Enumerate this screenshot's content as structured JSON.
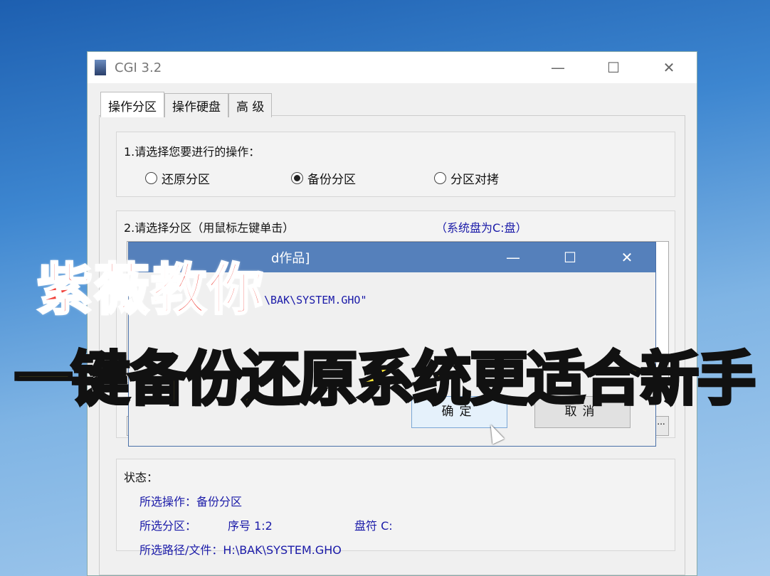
{
  "window": {
    "title": "CGI 3.2",
    "minimize": "—",
    "maximize": "☐",
    "close": "✕"
  },
  "tabs": [
    {
      "label": "操作分区"
    },
    {
      "label": "操作硬盘"
    },
    {
      "label": "高 级"
    }
  ],
  "step1": {
    "label": "1.请选择您要进行的操作：",
    "options": [
      {
        "label": "还原分区",
        "selected": false
      },
      {
        "label": "备份分区",
        "selected": true
      },
      {
        "label": "分区对拷",
        "selected": false
      }
    ]
  },
  "step2": {
    "label": "2.请选择分区（用鼠标左键单击）",
    "note": "（系统盘为C:盘）",
    "browse": "..."
  },
  "dialog": {
    "title": "d作品]",
    "message": "\\BAK\\SYSTEM.GHO\"",
    "ok": "确定",
    "cancel": "取消",
    "minimize": "—",
    "maximize": "☐",
    "close": "✕"
  },
  "status": {
    "label": "状态：",
    "operation": "所选操作：备份分区",
    "partition_label": "所选分区：",
    "index": "序号 1:2",
    "drive": "盘符 C:",
    "path": "所选路径/文件：H:\\BAK\\SYSTEM.GHO"
  },
  "overlay": {
    "line1": "紫薇教你",
    "line2": "一键备份还原系统更适合新手"
  }
}
